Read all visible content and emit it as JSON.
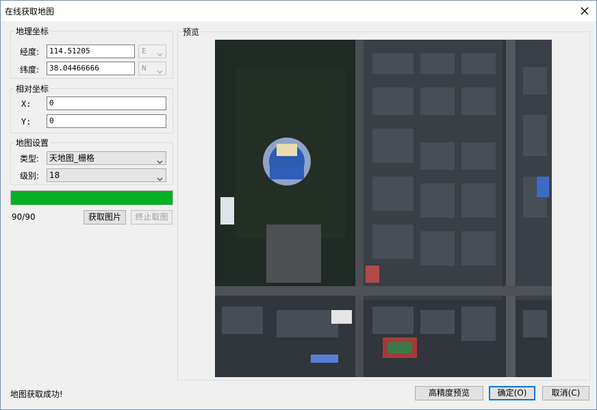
{
  "window": {
    "title": "在线获取地图",
    "close_icon": "close-icon"
  },
  "geo": {
    "group_label": "地理坐标",
    "longitude_label": "经度:",
    "longitude_value": "114.51205",
    "longitude_dir": "E",
    "latitude_label": "纬度:",
    "latitude_value": "38.04466666",
    "latitude_dir": "N"
  },
  "relative": {
    "group_label": "相对坐标",
    "x_label": "X:",
    "x_value": "0",
    "y_label": "Y:",
    "y_value": "0"
  },
  "map_settings": {
    "group_label": "地图设置",
    "type_label": "类型:",
    "type_value": "天地图_栅格",
    "level_label": "级别:",
    "level_value": "18"
  },
  "progress": {
    "text": "90/90",
    "fraction": 1.0,
    "color": "#06b025"
  },
  "actions": {
    "fetch_label": "获取图片",
    "stop_label": "终止取图"
  },
  "preview": {
    "group_label": "预览",
    "image_icon": "satellite-map-image"
  },
  "status_text": "地图获取成功!",
  "footer": {
    "hd_preview_label": "高精度预览",
    "ok_label": "确定(O)",
    "cancel_label": "取消(C)"
  }
}
